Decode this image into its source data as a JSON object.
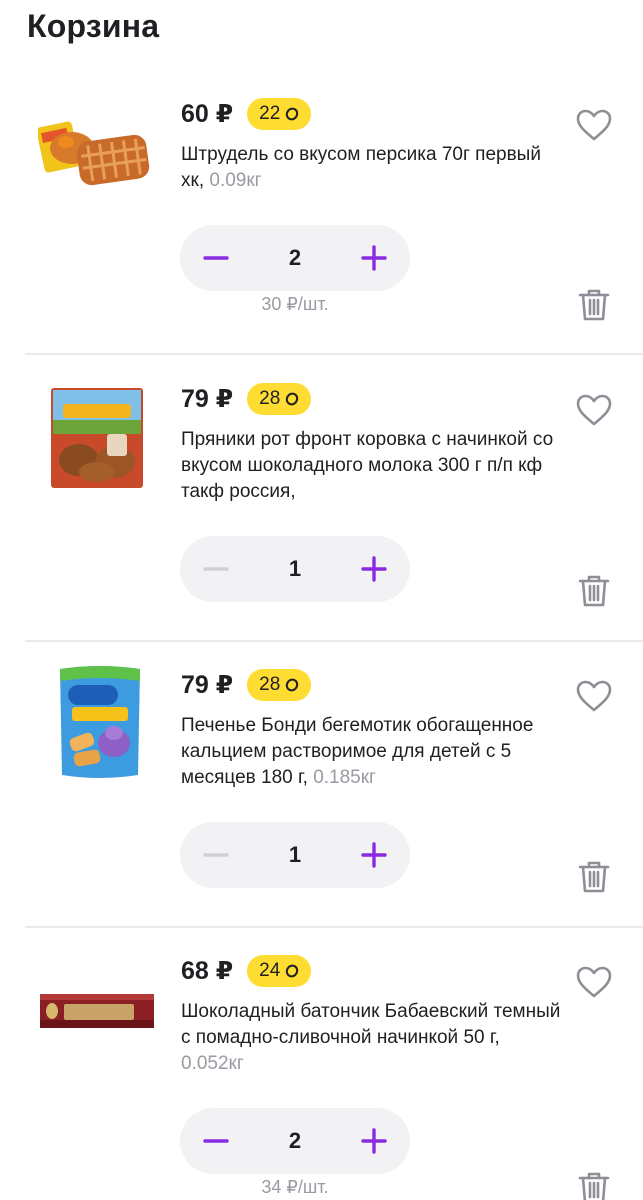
{
  "page": {
    "title": "Корзина"
  },
  "colors": {
    "accent": "#8a2be2",
    "bonus_bg": "#ffdc32",
    "muted": "#9a9aa3"
  },
  "items": [
    {
      "price": "60 ₽",
      "bonus": "22",
      "name": "Штрудель со вкусом персика 70г первый хк,",
      "weight": "0.09кг",
      "qty": "2",
      "unit_price": "30 ₽/шт.",
      "minus_active": true,
      "image_icon": "strudel-image"
    },
    {
      "price": "79 ₽",
      "bonus": "28",
      "name": "Пряники рот фронт коровка с начинкой со вкусом шоколадного молока 300 г п/п кф такф россия,",
      "weight": "",
      "qty": "1",
      "unit_price": "",
      "minus_active": false,
      "image_icon": "gingerbread-image"
    },
    {
      "price": "79 ₽",
      "bonus": "28",
      "name": "Печенье Бонди бегемотик обогащенное кальцием растворимое для детей с 5 месяцев 180 г,",
      "weight": "0.185кг",
      "qty": "1",
      "unit_price": "",
      "minus_active": false,
      "image_icon": "cookies-image"
    },
    {
      "price": "68 ₽",
      "bonus": "24",
      "name": "Шоколадный батончик Бабаевский темный с помадно-сливочной начинкой 50 г,",
      "weight": "0.052кг",
      "qty": "2",
      "unit_price": "34 ₽/шт.",
      "minus_active": true,
      "image_icon": "chocolate-bar-image"
    }
  ]
}
